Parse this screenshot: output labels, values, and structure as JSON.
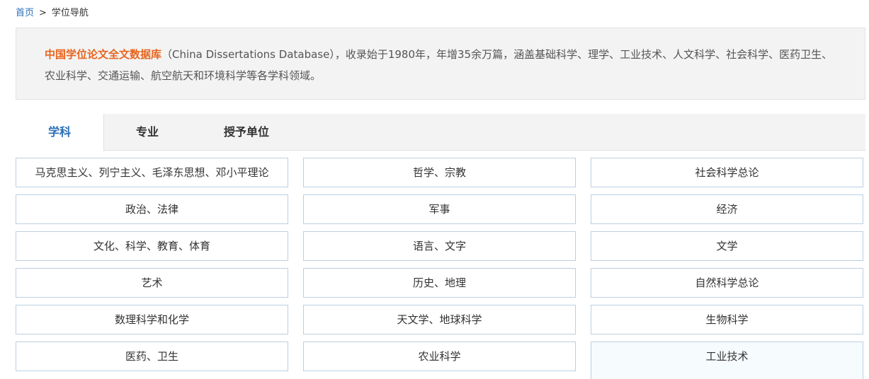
{
  "breadcrumb": {
    "home": "首页",
    "separator": ">",
    "current": "学位导航"
  },
  "intro": {
    "highlight": "中国学位论文全文数据库",
    "text": "（China Dissertations Database），收录始于1980年，年增35余万篇，涵盖基础科学、理学、工业技术、人文科学、社会科学、医药卫生、农业科学、交通运输、航空航天和环境科学等各学科领域。"
  },
  "tabs": [
    {
      "label": "学科"
    },
    {
      "label": "专业"
    },
    {
      "label": "授予单位"
    }
  ],
  "subjects": [
    "马克思主义、列宁主义、毛泽东思想、邓小平理论",
    "哲学、宗教",
    "社会科学总论",
    "政治、法律",
    "军事",
    "经济",
    "文化、科学、教育、体育",
    "语言、文字",
    "文学",
    "艺术",
    "历史、地理",
    "自然科学总论",
    "数理科学和化学",
    "天文学、地球科学",
    "生物科学",
    "医药、卫生",
    "农业科学",
    "工业技术"
  ],
  "colors": {
    "link": "#2a6fb8",
    "highlight": "#e8641d",
    "cell_border": "#bccfe0"
  }
}
